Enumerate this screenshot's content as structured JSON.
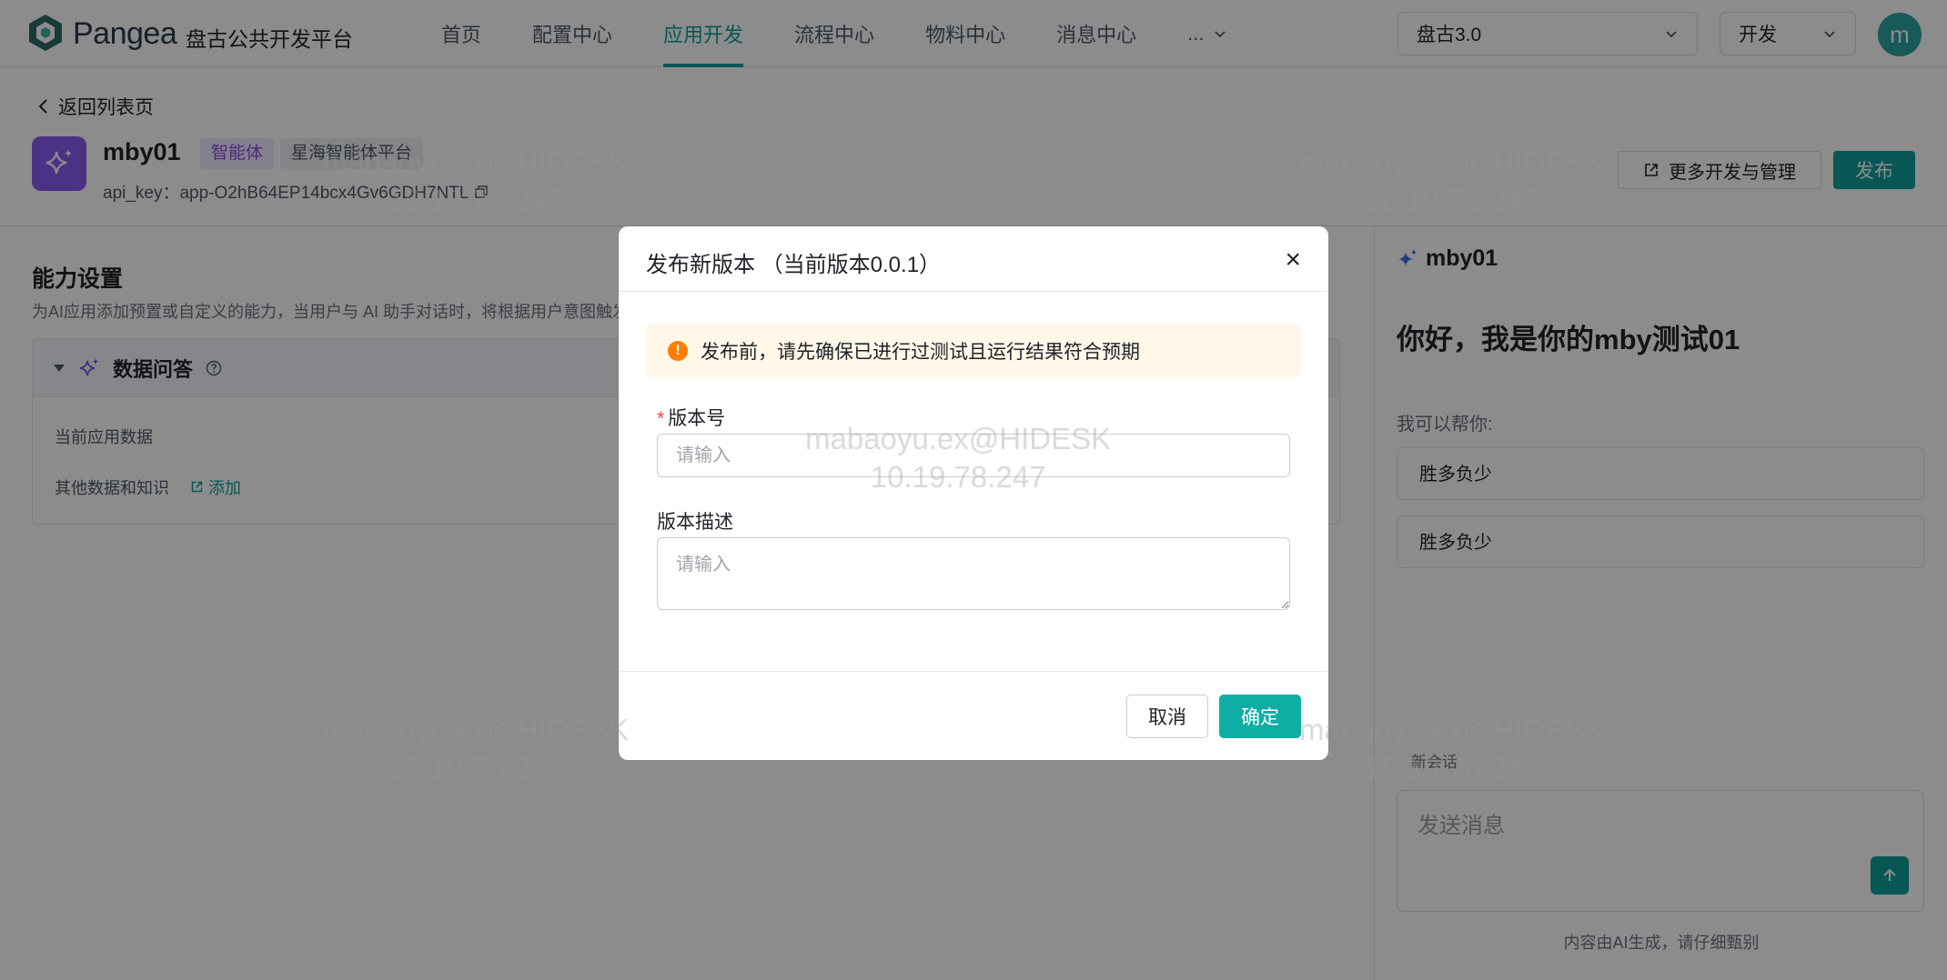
{
  "topbar": {
    "brand": "Pangea",
    "brand_sub": "盘古公共开发平台",
    "nav": [
      "首页",
      "配置中心",
      "应用开发",
      "流程中心",
      "物料中心",
      "消息中心"
    ],
    "nav_more": "...",
    "active_nav": "应用开发",
    "platform_select": "盘古3.0",
    "env_select": "开发",
    "avatar": "m"
  },
  "app": {
    "back": "返回列表页",
    "name": "mby01",
    "tag_type": "智能体",
    "tag_platform": "星海智能体平台",
    "api_key": "api_key：app-O2hB64EP14bcx4Gv6GDH7NTL",
    "more_btn": "更多开发与管理",
    "publish_btn": "发布"
  },
  "capability": {
    "title": "能力设置",
    "desc": "为AI应用添加预置或自定义的能力，当用户与 AI 助手对话时，将根据用户意图触发",
    "panel_title": "数据问答",
    "row1": "当前应用数据",
    "row2": "其他数据和知识",
    "add_link": "添加"
  },
  "chat": {
    "name": "mby01",
    "greeting": "你好，我是你的mby测试01",
    "help": "我可以帮你:",
    "suggestions": [
      "胜多负少",
      "胜多负少"
    ],
    "new_chat": "新会话",
    "input_placeholder": "发送消息",
    "ai_note": "内容由AI生成，请仔细甄别"
  },
  "modal": {
    "title": "发布新版本 （当前版本0.0.1）",
    "alert": "发布前，请先确保已进行过测试且运行结果符合预期",
    "version_label": "版本号",
    "version_placeholder": "请输入",
    "desc_label": "版本描述",
    "desc_placeholder": "请输入",
    "cancel": "取消",
    "confirm": "确定"
  },
  "watermark": {
    "user": "mabaoyu.ex@HIDESK",
    "ip": "10.19.78.247"
  },
  "colors": {
    "accent": "#0f9e9a",
    "tag_purple": "#8a4fe0",
    "warning": "#ff7d00",
    "required": "#f53f3f"
  }
}
